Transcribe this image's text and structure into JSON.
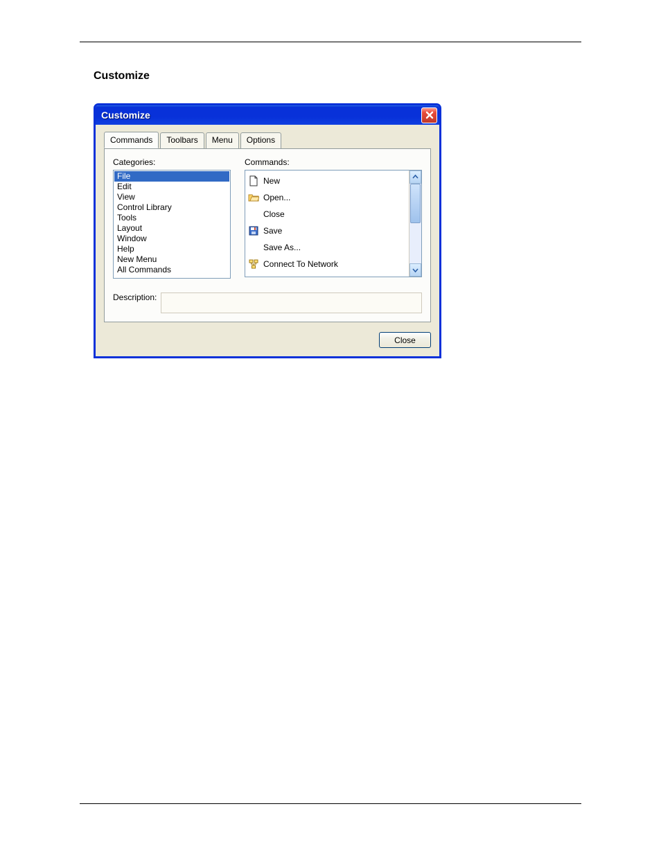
{
  "page": {
    "section_heading": "Customize"
  },
  "dialog": {
    "title": "Customize",
    "tabs": [
      "Commands",
      "Toolbars",
      "Menu",
      "Options"
    ],
    "active_tab_index": 0,
    "categories_label": "Categories:",
    "commands_label": "Commands:",
    "categories": [
      "File",
      "Edit",
      "View",
      "Control Library",
      "Tools",
      "Layout",
      "Window",
      "Help",
      "New Menu",
      "All Commands"
    ],
    "selected_category_index": 0,
    "commands": [
      {
        "label": "New",
        "icon": "file-new-icon"
      },
      {
        "label": "Open...",
        "icon": "folder-open-icon"
      },
      {
        "label": "Close",
        "icon": ""
      },
      {
        "label": "Save",
        "icon": "save-icon"
      },
      {
        "label": "Save As...",
        "icon": ""
      },
      {
        "label": "Connect To Network",
        "icon": "network-icon"
      }
    ],
    "description_label": "Description:",
    "description_value": "",
    "close_button": "Close"
  }
}
